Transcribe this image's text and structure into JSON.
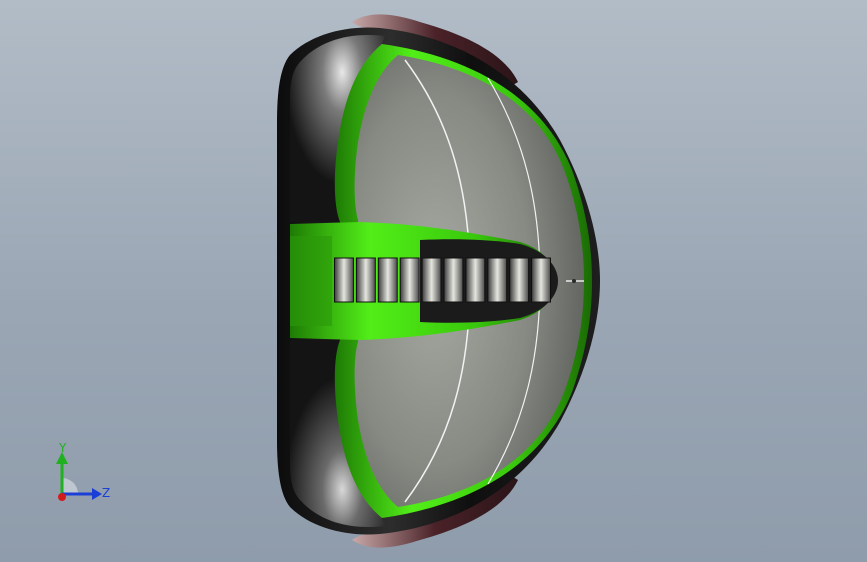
{
  "viewport": {
    "background_top": "#b2bcc7",
    "background_bottom": "#8f9cab"
  },
  "model": {
    "body_color": "#1a1a1a",
    "face_color": "#8a8c86",
    "accent_color": "#38d20a",
    "rim_color": "#4a2228",
    "alignment_bars": 10
  },
  "triad": {
    "y_label": "Y",
    "z_label": "Z",
    "y_color": "#1fb11f",
    "z_color": "#1b3fd6",
    "x_color": "#d11c1c"
  }
}
